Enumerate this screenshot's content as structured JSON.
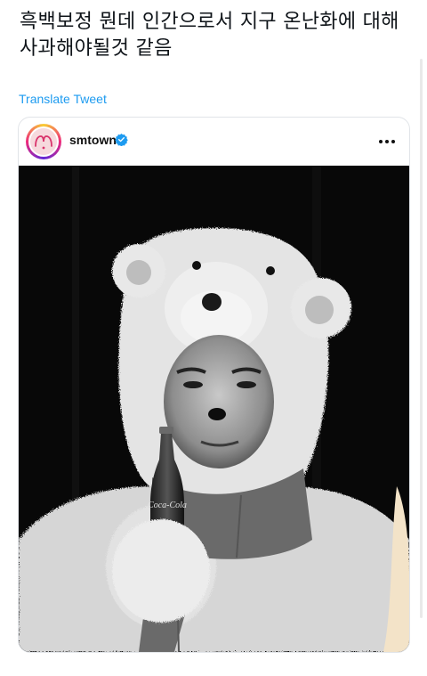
{
  "tweet": {
    "text_line1": "흑백보정 뭔데 인간으로서 지구 온난화에 대해",
    "text_line2": "사과해야될것 같음",
    "translate_label": "Translate Tweet"
  },
  "embed": {
    "platform": "instagram",
    "username": "smtown",
    "verified_icon": "verified-badge-icon",
    "more_icon": "more-options-icon",
    "avatar_logo_text": "SM",
    "bottle_label": "Coca-Cola",
    "photo_description_tone": "black-and-white"
  },
  "colors": {
    "link": "#1d9bf0",
    "verified": "#1d9bf0",
    "text": "#0f1419"
  }
}
